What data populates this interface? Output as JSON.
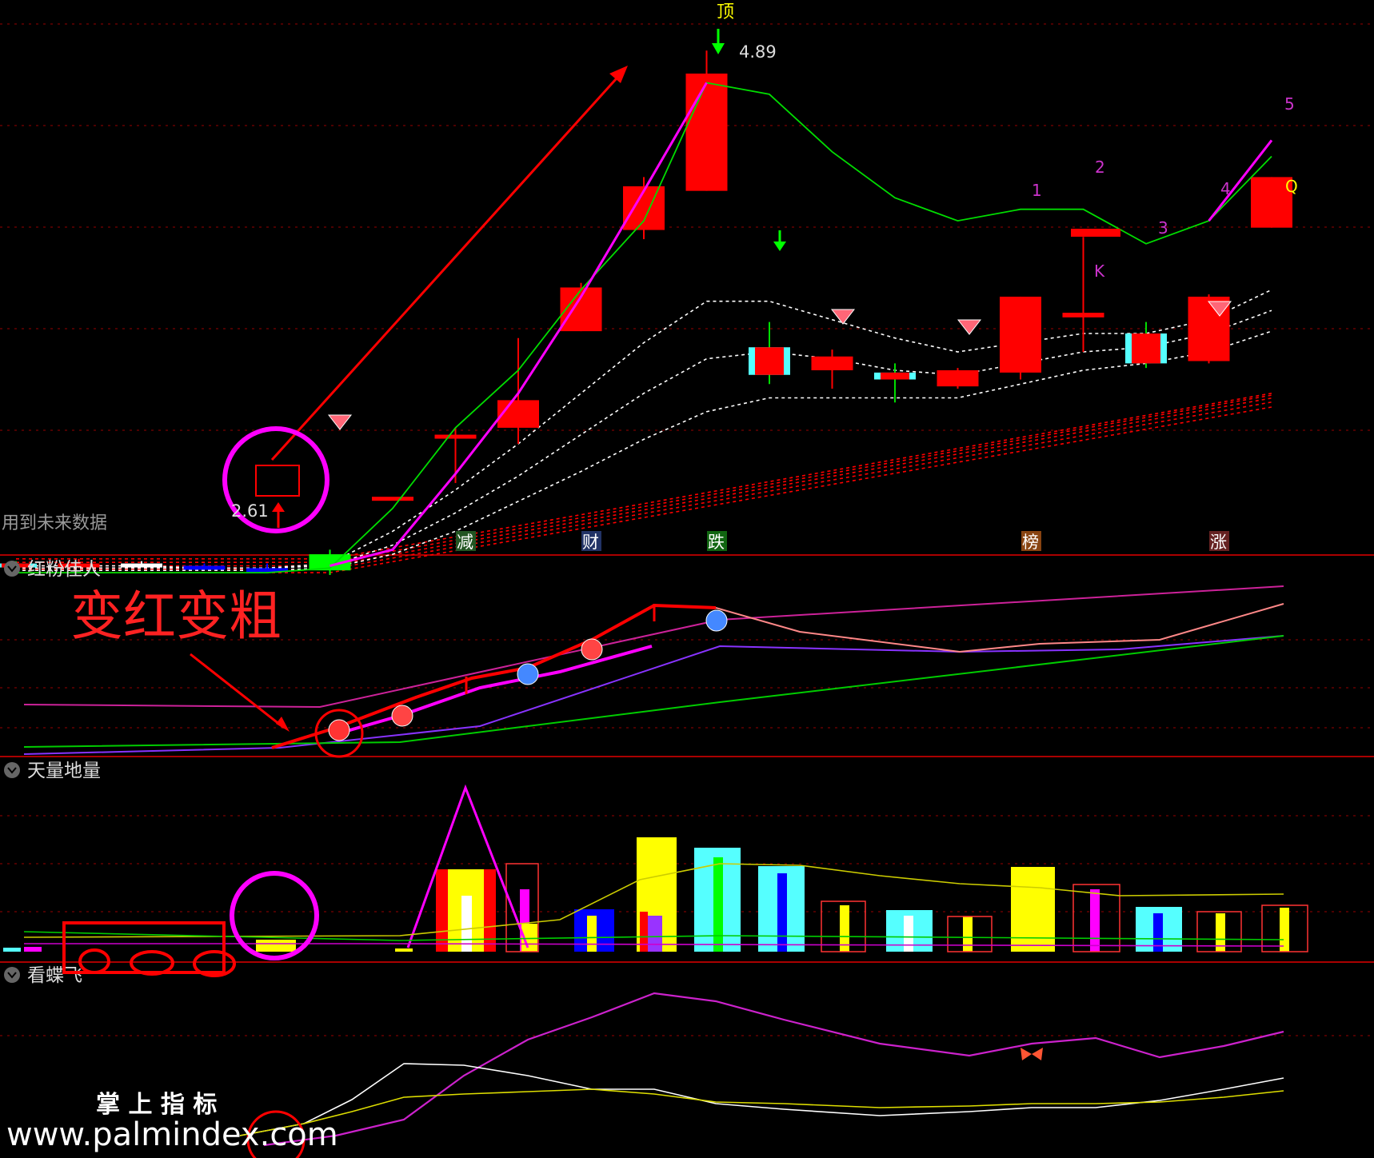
{
  "colors": {
    "background": "#000000",
    "up": "#ff0000",
    "down_cyan": "#55ffff",
    "green": "#00dd00",
    "magenta": "#ff00ff",
    "yellow": "#ffff00",
    "white": "#ffffff",
    "divider": "#aa0000",
    "grid": "#aa0000",
    "pink": "#ff8888",
    "purple": "#9900ff",
    "blue": "#0000ff"
  },
  "panel_titles": [
    "红粉佳人",
    "天量地量",
    "看蝶飞"
  ],
  "labels": {
    "future_data": "用到未来数据",
    "top_marker": "顶",
    "high_value": "4.89",
    "low_value": "2.61",
    "annotation_main": "变红变粗",
    "watermark_cn": "掌 上 指 标",
    "watermark_url": "www.palmindex.com",
    "note_q": "Q",
    "note_k": "K",
    "stamp_jian": "减",
    "stamp_cai": "财",
    "stamp_die": "跌",
    "stamp_bang": "榜",
    "stamp_zhang": "涨",
    "wave_1": "1",
    "wave_2": "2",
    "wave_3": "3",
    "wave_4": "4",
    "wave_5": "5"
  },
  "chart_data": [
    {
      "type": "candlestick",
      "title": "",
      "candles": [
        {
          "open": 2.66,
          "close": 2.66,
          "high": 2.67,
          "low": 2.65,
          "color": "cyan"
        },
        {
          "open": 2.66,
          "close": 2.66,
          "high": 2.68,
          "low": 2.64,
          "color": "red"
        },
        {
          "open": 2.66,
          "close": 2.66,
          "high": 2.67,
          "low": 2.65,
          "color": "white"
        },
        {
          "open": 2.65,
          "close": 2.65,
          "high": 2.66,
          "low": 2.64,
          "color": "blue"
        },
        {
          "open": 2.64,
          "close": 2.64,
          "high": 2.66,
          "low": 2.63,
          "color": "blue"
        },
        {
          "open": 2.63,
          "close": 2.7,
          "high": 2.72,
          "low": 2.61,
          "color": "green"
        },
        {
          "open": 2.95,
          "close": 2.95,
          "high": 2.95,
          "low": 2.95,
          "color": "red"
        },
        {
          "open": 3.22,
          "close": 3.22,
          "high": 3.25,
          "low": 3.01,
          "color": "red"
        },
        {
          "open": 3.25,
          "close": 3.37,
          "high": 3.64,
          "low": 3.18,
          "color": "red"
        },
        {
          "open": 3.67,
          "close": 3.86,
          "high": 3.88,
          "low": 3.67,
          "color": "red"
        },
        {
          "open": 4.11,
          "close": 4.3,
          "high": 4.34,
          "low": 4.07,
          "color": "red"
        },
        {
          "open": 4.28,
          "close": 4.79,
          "high": 4.89,
          "low": 4.28,
          "color": "red"
        },
        {
          "open": 3.48,
          "close": 3.6,
          "high": 3.71,
          "low": 3.44,
          "color": "cyan"
        },
        {
          "open": 3.5,
          "close": 3.56,
          "high": 3.59,
          "low": 3.42,
          "color": "red"
        },
        {
          "open": 3.46,
          "close": 3.49,
          "high": 3.53,
          "low": 3.36,
          "color": "cyan"
        },
        {
          "open": 3.43,
          "close": 3.5,
          "high": 3.51,
          "low": 3.42,
          "color": "red"
        },
        {
          "open": 3.49,
          "close": 3.82,
          "high": 3.82,
          "low": 3.46,
          "color": "red"
        },
        {
          "open": 3.73,
          "close": 3.75,
          "high": 4.08,
          "low": 3.58,
          "color": "red"
        },
        {
          "open": 3.53,
          "close": 3.66,
          "high": 3.71,
          "low": 3.51,
          "color": "cyan"
        },
        {
          "open": 3.54,
          "close": 3.82,
          "high": 3.83,
          "low": 3.53,
          "color": "red"
        },
        {
          "open": 4.12,
          "close": 4.34,
          "high": 4.34,
          "low": 4.12,
          "color": "red"
        }
      ],
      "ma_green": [
        2.62,
        2.62,
        2.62,
        2.62,
        2.62,
        2.64,
        2.9,
        3.25,
        3.5,
        3.85,
        4.15,
        4.75,
        4.7,
        4.45,
        4.25,
        4.15,
        4.2,
        4.2,
        4.05,
        4.15,
        4.43
      ],
      "ma_magenta_from_index_5": [
        2.65,
        2.72,
        3.05,
        3.4,
        3.82,
        4.28,
        4.75
      ],
      "ma_magenta_tail": [
        {
          "i": 19,
          "v": 4.15
        },
        {
          "i": 20,
          "v": 4.5
        }
      ]
    },
    {
      "type": "line",
      "title": "红粉佳人",
      "series": []
    },
    {
      "type": "bar",
      "title": "天量地量",
      "series": []
    },
    {
      "type": "line",
      "title": "看蝶飞",
      "series": []
    }
  ]
}
